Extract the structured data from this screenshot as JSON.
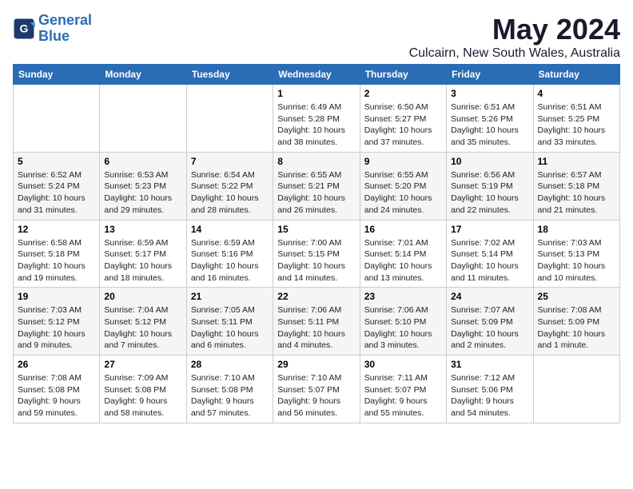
{
  "logo": {
    "line1": "General",
    "line2": "Blue"
  },
  "title": "May 2024",
  "location": "Culcairn, New South Wales, Australia",
  "weekdays": [
    "Sunday",
    "Monday",
    "Tuesday",
    "Wednesday",
    "Thursday",
    "Friday",
    "Saturday"
  ],
  "weeks": [
    [
      null,
      null,
      null,
      {
        "day": "1",
        "sunrise": "Sunrise: 6:49 AM",
        "sunset": "Sunset: 5:28 PM",
        "daylight": "Daylight: 10 hours and 38 minutes."
      },
      {
        "day": "2",
        "sunrise": "Sunrise: 6:50 AM",
        "sunset": "Sunset: 5:27 PM",
        "daylight": "Daylight: 10 hours and 37 minutes."
      },
      {
        "day": "3",
        "sunrise": "Sunrise: 6:51 AM",
        "sunset": "Sunset: 5:26 PM",
        "daylight": "Daylight: 10 hours and 35 minutes."
      },
      {
        "day": "4",
        "sunrise": "Sunrise: 6:51 AM",
        "sunset": "Sunset: 5:25 PM",
        "daylight": "Daylight: 10 hours and 33 minutes."
      }
    ],
    [
      {
        "day": "5",
        "sunrise": "Sunrise: 6:52 AM",
        "sunset": "Sunset: 5:24 PM",
        "daylight": "Daylight: 10 hours and 31 minutes."
      },
      {
        "day": "6",
        "sunrise": "Sunrise: 6:53 AM",
        "sunset": "Sunset: 5:23 PM",
        "daylight": "Daylight: 10 hours and 29 minutes."
      },
      {
        "day": "7",
        "sunrise": "Sunrise: 6:54 AM",
        "sunset": "Sunset: 5:22 PM",
        "daylight": "Daylight: 10 hours and 28 minutes."
      },
      {
        "day": "8",
        "sunrise": "Sunrise: 6:55 AM",
        "sunset": "Sunset: 5:21 PM",
        "daylight": "Daylight: 10 hours and 26 minutes."
      },
      {
        "day": "9",
        "sunrise": "Sunrise: 6:55 AM",
        "sunset": "Sunset: 5:20 PM",
        "daylight": "Daylight: 10 hours and 24 minutes."
      },
      {
        "day": "10",
        "sunrise": "Sunrise: 6:56 AM",
        "sunset": "Sunset: 5:19 PM",
        "daylight": "Daylight: 10 hours and 22 minutes."
      },
      {
        "day": "11",
        "sunrise": "Sunrise: 6:57 AM",
        "sunset": "Sunset: 5:18 PM",
        "daylight": "Daylight: 10 hours and 21 minutes."
      }
    ],
    [
      {
        "day": "12",
        "sunrise": "Sunrise: 6:58 AM",
        "sunset": "Sunset: 5:18 PM",
        "daylight": "Daylight: 10 hours and 19 minutes."
      },
      {
        "day": "13",
        "sunrise": "Sunrise: 6:59 AM",
        "sunset": "Sunset: 5:17 PM",
        "daylight": "Daylight: 10 hours and 18 minutes."
      },
      {
        "day": "14",
        "sunrise": "Sunrise: 6:59 AM",
        "sunset": "Sunset: 5:16 PM",
        "daylight": "Daylight: 10 hours and 16 minutes."
      },
      {
        "day": "15",
        "sunrise": "Sunrise: 7:00 AM",
        "sunset": "Sunset: 5:15 PM",
        "daylight": "Daylight: 10 hours and 14 minutes."
      },
      {
        "day": "16",
        "sunrise": "Sunrise: 7:01 AM",
        "sunset": "Sunset: 5:14 PM",
        "daylight": "Daylight: 10 hours and 13 minutes."
      },
      {
        "day": "17",
        "sunrise": "Sunrise: 7:02 AM",
        "sunset": "Sunset: 5:14 PM",
        "daylight": "Daylight: 10 hours and 11 minutes."
      },
      {
        "day": "18",
        "sunrise": "Sunrise: 7:03 AM",
        "sunset": "Sunset: 5:13 PM",
        "daylight": "Daylight: 10 hours and 10 minutes."
      }
    ],
    [
      {
        "day": "19",
        "sunrise": "Sunrise: 7:03 AM",
        "sunset": "Sunset: 5:12 PM",
        "daylight": "Daylight: 10 hours and 9 minutes."
      },
      {
        "day": "20",
        "sunrise": "Sunrise: 7:04 AM",
        "sunset": "Sunset: 5:12 PM",
        "daylight": "Daylight: 10 hours and 7 minutes."
      },
      {
        "day": "21",
        "sunrise": "Sunrise: 7:05 AM",
        "sunset": "Sunset: 5:11 PM",
        "daylight": "Daylight: 10 hours and 6 minutes."
      },
      {
        "day": "22",
        "sunrise": "Sunrise: 7:06 AM",
        "sunset": "Sunset: 5:11 PM",
        "daylight": "Daylight: 10 hours and 4 minutes."
      },
      {
        "day": "23",
        "sunrise": "Sunrise: 7:06 AM",
        "sunset": "Sunset: 5:10 PM",
        "daylight": "Daylight: 10 hours and 3 minutes."
      },
      {
        "day": "24",
        "sunrise": "Sunrise: 7:07 AM",
        "sunset": "Sunset: 5:09 PM",
        "daylight": "Daylight: 10 hours and 2 minutes."
      },
      {
        "day": "25",
        "sunrise": "Sunrise: 7:08 AM",
        "sunset": "Sunset: 5:09 PM",
        "daylight": "Daylight: 10 hours and 1 minute."
      }
    ],
    [
      {
        "day": "26",
        "sunrise": "Sunrise: 7:08 AM",
        "sunset": "Sunset: 5:08 PM",
        "daylight": "Daylight: 9 hours and 59 minutes."
      },
      {
        "day": "27",
        "sunrise": "Sunrise: 7:09 AM",
        "sunset": "Sunset: 5:08 PM",
        "daylight": "Daylight: 9 hours and 58 minutes."
      },
      {
        "day": "28",
        "sunrise": "Sunrise: 7:10 AM",
        "sunset": "Sunset: 5:08 PM",
        "daylight": "Daylight: 9 hours and 57 minutes."
      },
      {
        "day": "29",
        "sunrise": "Sunrise: 7:10 AM",
        "sunset": "Sunset: 5:07 PM",
        "daylight": "Daylight: 9 hours and 56 minutes."
      },
      {
        "day": "30",
        "sunrise": "Sunrise: 7:11 AM",
        "sunset": "Sunset: 5:07 PM",
        "daylight": "Daylight: 9 hours and 55 minutes."
      },
      {
        "day": "31",
        "sunrise": "Sunrise: 7:12 AM",
        "sunset": "Sunset: 5:06 PM",
        "daylight": "Daylight: 9 hours and 54 minutes."
      },
      null
    ]
  ]
}
